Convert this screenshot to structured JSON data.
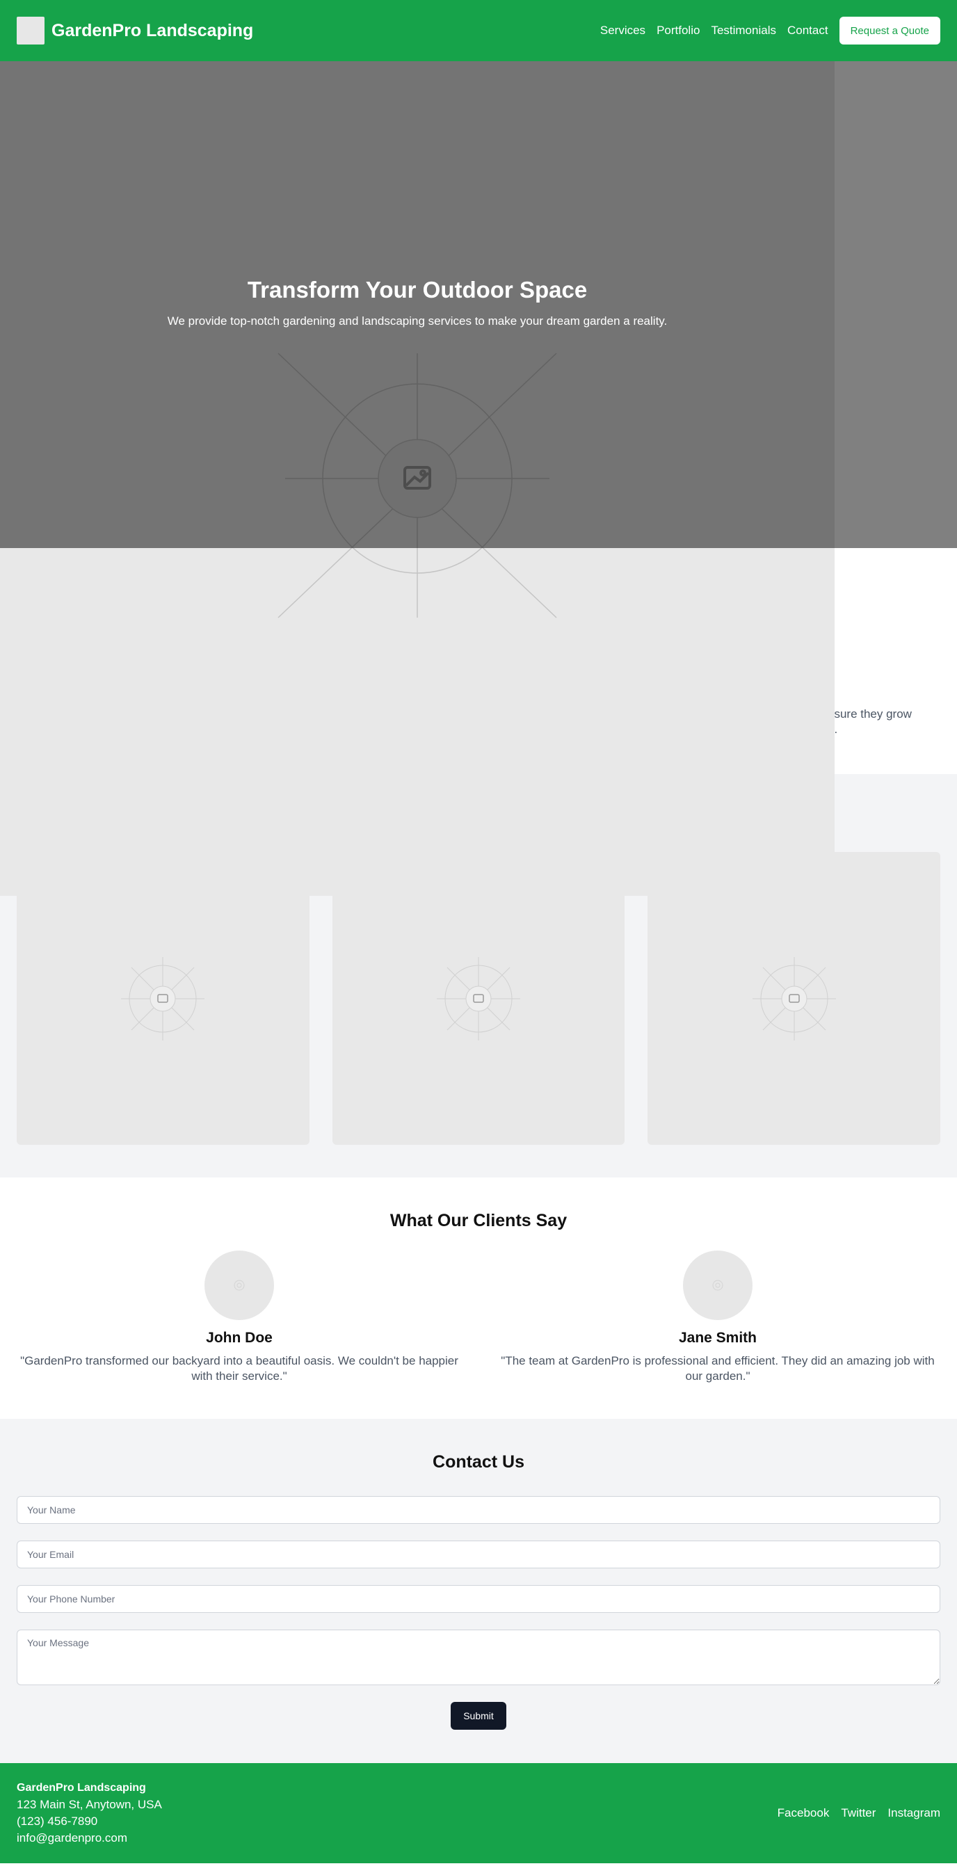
{
  "header": {
    "brand": "GardenPro Landscaping",
    "nav": [
      "Services",
      "Portfolio",
      "Testimonials",
      "Contact"
    ],
    "cta": "Request a Quote"
  },
  "hero": {
    "title": "Transform Your Outdoor Space",
    "subtitle": "We provide top-notch gardening and landscaping services to make your dream garden a reality."
  },
  "services": {
    "partial_line_1": "nsure they grow",
    "partial_line_2": "g."
  },
  "testimonials": {
    "title": "What Our Clients Say",
    "items": [
      {
        "name": "John Doe",
        "quote": "\"GardenPro transformed our backyard into a beautiful oasis. We couldn't be happier with their service.\""
      },
      {
        "name": "Jane Smith",
        "quote": "\"The team at GardenPro is professional and efficient. They did an amazing job with our garden.\""
      }
    ]
  },
  "contact": {
    "title": "Contact Us",
    "name_placeholder": "Your Name",
    "email_placeholder": "Your Email",
    "phone_placeholder": "Your Phone Number",
    "message_placeholder": "Your Message",
    "submit": "Submit"
  },
  "footer": {
    "name": "GardenPro Landscaping",
    "address": "123 Main St, Anytown, USA",
    "phone": "(123) 456-7890",
    "email": "info@gardenpro.com",
    "social": [
      "Facebook",
      "Twitter",
      "Instagram"
    ]
  },
  "colors": {
    "brand_green": "#16a34a",
    "dark_button": "#111827",
    "section_gray": "#f3f4f6"
  }
}
